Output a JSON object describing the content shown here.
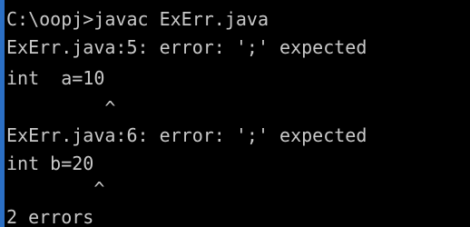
{
  "console": {
    "lines": [
      "C:\\oopj>javac ExErr.java",
      "ExErr.java:5: error: ';' expected",
      "int  a=10",
      "         ^",
      "ExErr.java:6: error: ';' expected",
      "int b=20",
      "        ^",
      "2 errors"
    ]
  },
  "colors": {
    "background": "#000000",
    "text": "#c9c9c9",
    "window_border": "#2b6fc4"
  }
}
